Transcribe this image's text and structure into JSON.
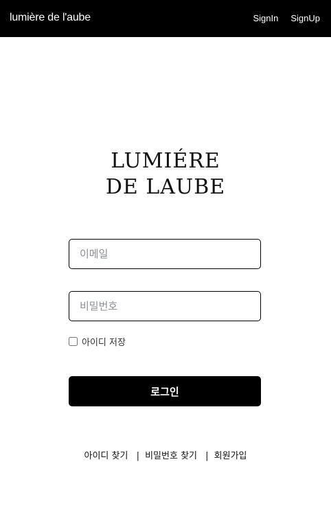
{
  "navbar": {
    "brand": "lumière de l'aube",
    "signin": "SignIn",
    "signup": "SignUp"
  },
  "logo": {
    "line1": "LUMIÉRE",
    "line2": "DE LAUBE"
  },
  "form": {
    "email_placeholder": "이메일",
    "password_placeholder": "비밀번호",
    "remember_label": "아이디 저장",
    "remember_checked": false,
    "login_label": "로그인"
  },
  "links": {
    "find_id": "아이디 찾기",
    "find_password": "비밀번호 찾기",
    "signup": "회원가입",
    "separator": "|"
  },
  "colors": {
    "navbar_bg": "#000000",
    "button_bg": "#000000",
    "page_bg": "#ffffff"
  }
}
